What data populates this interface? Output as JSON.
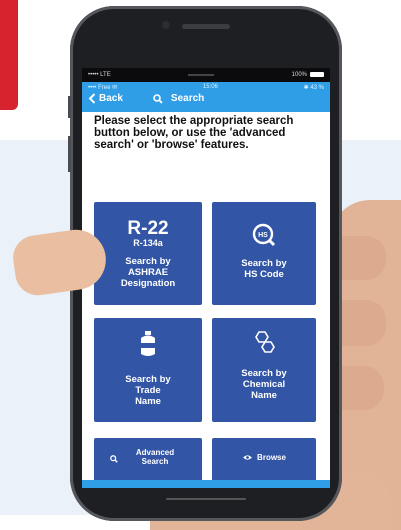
{
  "status_bar": {
    "carrier": "••••• LTE",
    "time": "",
    "battery": "100%"
  },
  "nav": {
    "sub_left": "•••• Free ✉",
    "sub_time": "15:06",
    "sub_right": "✱ 43 %",
    "back_label": "Back",
    "title": "Search"
  },
  "intro_text": "Please select the appropriate search button below, or use the 'advanced search' or 'browse' features.",
  "tiles": [
    {
      "id": "ashrae",
      "big": "R-22",
      "small": "R-134a",
      "label_lines": [
        "Search by",
        "ASHRAE",
        "Designation"
      ]
    },
    {
      "id": "hs",
      "icon_text": "HS",
      "label_lines": [
        "Search by",
        "HS Code"
      ]
    },
    {
      "id": "trade",
      "label_lines": [
        "Search by",
        "Trade",
        "Name"
      ]
    },
    {
      "id": "chemical",
      "label_lines": [
        "Search by",
        "Chemical",
        "Name"
      ]
    },
    {
      "id": "advanced",
      "label_lines": [
        "Advanced",
        "Search"
      ]
    },
    {
      "id": "browse",
      "label": "Browse"
    }
  ],
  "colors": {
    "navbar": "#2f9ee6",
    "tile": "#3355a6",
    "accent_red": "#d6232e"
  }
}
